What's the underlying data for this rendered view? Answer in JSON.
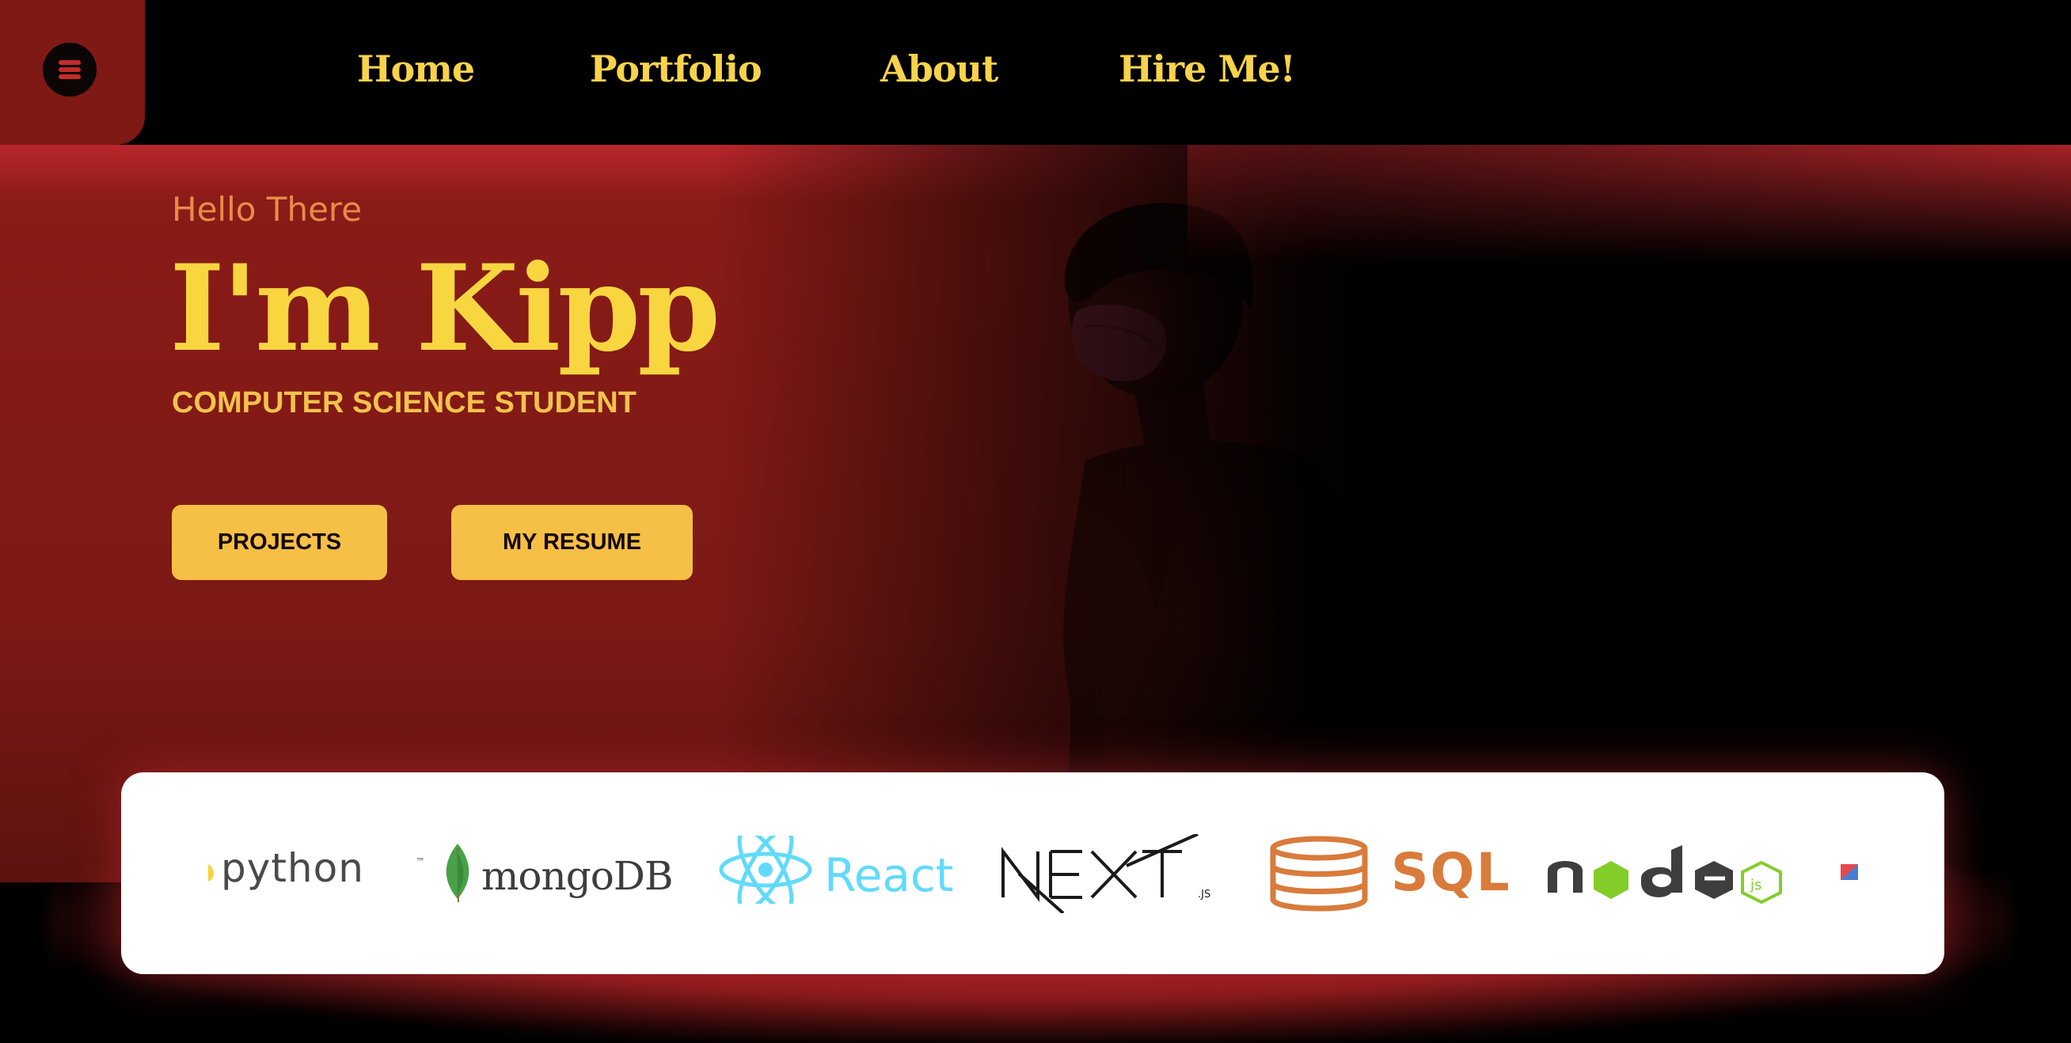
{
  "nav": {
    "menu_icon": "hamburger-menu-icon",
    "links": [
      "Home",
      "Portfolio",
      "About",
      "Hire Me!"
    ]
  },
  "hero": {
    "greeting": "Hello There",
    "headline": "I'm Kipp",
    "subtitle": "COMPUTER SCIENCE STUDENT",
    "buttons": {
      "projects": "PROJECTS",
      "resume": "MY RESUME"
    }
  },
  "tech_strip": {
    "logos": [
      {
        "name": "python-logo",
        "label": "python",
        "mark": "™"
      },
      {
        "name": "mongodb-logo",
        "label": "mongoDB"
      },
      {
        "name": "react-logo",
        "label": "React"
      },
      {
        "name": "nextjs-logo",
        "label": "NEXT.JS"
      },
      {
        "name": "sql-logo",
        "label": "SQL"
      },
      {
        "name": "nodejs-logo",
        "label": "node"
      }
    ]
  },
  "colors": {
    "accent_yellow": "#f8d640",
    "button_yellow": "#f6bf45",
    "hero_red": "#7c1915",
    "background": "#000000"
  }
}
